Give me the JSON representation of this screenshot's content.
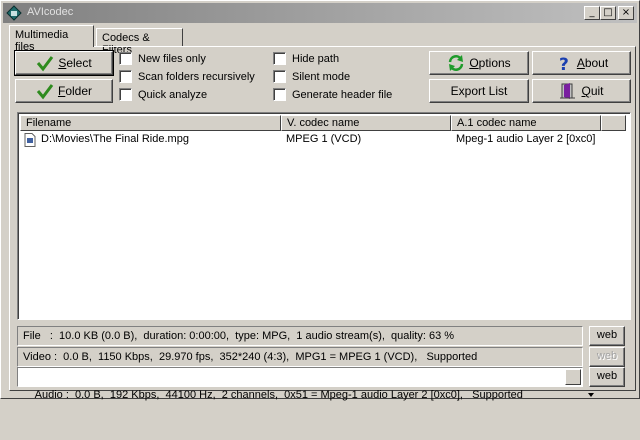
{
  "window": {
    "title": "AVIcodec",
    "minimize": "_",
    "maximize": "□",
    "close": "×"
  },
  "tabs": [
    {
      "label": "Multimedia files",
      "active": true
    },
    {
      "label": "Codecs & Filters",
      "active": false
    }
  ],
  "buttons": {
    "select": {
      "label_u": "S",
      "label_rest": "elect"
    },
    "folder": {
      "label_u": "F",
      "label_rest": "older"
    },
    "options": {
      "label_u": "O",
      "label_rest": "ptions"
    },
    "about": {
      "label_u": "A",
      "label_rest": "bout"
    },
    "export_list": {
      "label": "Export List"
    },
    "quit": {
      "label_u": "Q",
      "label_rest": "uit"
    }
  },
  "checkboxes": [
    {
      "label": "New files only",
      "checked": false
    },
    {
      "label": "Scan folders recursively",
      "checked": false
    },
    {
      "label": "Quick analyze",
      "checked": false
    },
    {
      "label": "Hide path",
      "checked": false
    },
    {
      "label": "Silent mode",
      "checked": false
    },
    {
      "label": "Generate header file",
      "checked": false
    }
  ],
  "list": {
    "columns": [
      "Filename",
      "V. codec name",
      "A.1 codec name"
    ],
    "rows": [
      {
        "filename": "D:\\Movies\\The Final Ride.mpg",
        "vcodec": "MPEG 1 (VCD)",
        "acodec": "Mpeg-1 audio Layer 2 [0xc0]",
        "icon": "media-file-icon"
      }
    ]
  },
  "info": {
    "file": "File   :  10.0 KB (0.0 B),  duration: 0:00:00,  type: MPG,  1 audio stream(s),  quality: 63 %",
    "video": "Video :  0.0 B,  1150 Kbps,  29.970 fps,  352*240 (4:3),  MPG1 = MPEG 1 (VCD),   Supported",
    "audio": "Audio :  0.0 B,  192 Kbps,  44100 Hz,  2 channels,  0x51 = Mpeg-1 audio Layer 2 [0xc0],   Supported",
    "web_label": "web"
  },
  "colors": {
    "check_green": "#2e8b1e",
    "options_green": "#1e9a2a",
    "about_blue": "#1a3fb0",
    "quit_purple": "#7a1fa0"
  }
}
